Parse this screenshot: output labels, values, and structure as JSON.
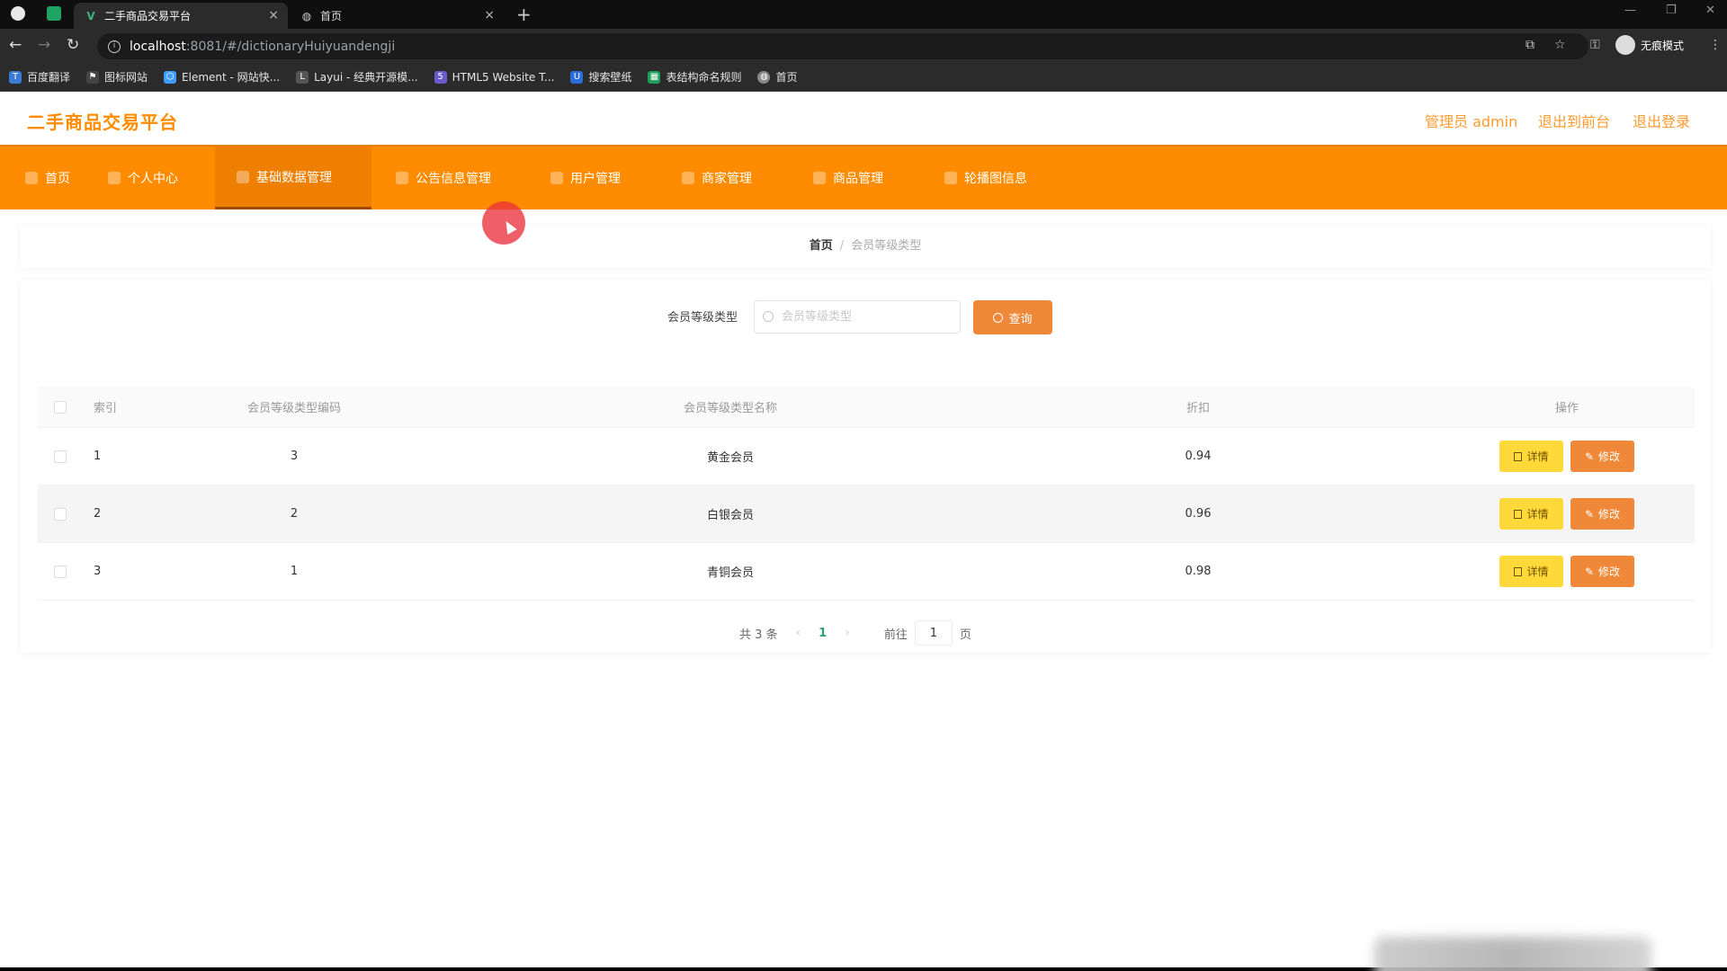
{
  "browser": {
    "tabs": [
      {
        "title": "二手商品交易平台",
        "active": true
      },
      {
        "title": "首页",
        "active": false
      }
    ],
    "address": {
      "host": "localhost",
      "path": ":8081/#/dictionaryHuiyuandengji"
    },
    "profile_label": "无痕模式",
    "bookmarks": [
      {
        "label": "百度翻译",
        "icon": "translate-icon",
        "color": "#3a7bd5"
      },
      {
        "label": "图标网站",
        "icon": "flag-icon",
        "color": "#444444"
      },
      {
        "label": "Element - 网站快...",
        "icon": "element-icon",
        "color": "#409eff"
      },
      {
        "label": "Layui - 经典开源模...",
        "icon": "layui-icon",
        "color": "#555555"
      },
      {
        "label": "HTML5 Website T...",
        "icon": "html5-icon",
        "color": "#6a5acd"
      },
      {
        "label": "搜索壁纸",
        "icon": "wallpaper-icon",
        "color": "#2b6cd9"
      },
      {
        "label": "表结构命名规则",
        "icon": "sheet-icon",
        "color": "#1e9e5a"
      },
      {
        "label": "首页",
        "icon": "globe-icon",
        "color": "#888888"
      }
    ]
  },
  "app": {
    "title": "二手商品交易平台",
    "header_links": {
      "admin": "管理员 admin",
      "front": "退出到前台",
      "logout": "退出登录"
    },
    "nav": [
      {
        "label": "首页",
        "active": false
      },
      {
        "label": "个人中心",
        "active": false
      },
      {
        "label": "基础数据管理",
        "active": true
      },
      {
        "label": "公告信息管理",
        "active": false
      },
      {
        "label": "用户管理",
        "active": false
      },
      {
        "label": "商家管理",
        "active": false
      },
      {
        "label": "商品管理",
        "active": false
      },
      {
        "label": "轮播图信息",
        "active": false
      }
    ],
    "breadcrumb": {
      "home": "首页",
      "separator": "/",
      "current": "会员等级类型"
    },
    "search": {
      "label": "会员等级类型",
      "placeholder": "会员等级类型",
      "button": "查询"
    },
    "table": {
      "headers": {
        "index": "索引",
        "code": "会员等级类型编码",
        "name": "会员等级类型名称",
        "discount": "折扣",
        "ops": "操作"
      },
      "rows": [
        {
          "index": "1",
          "code": "3",
          "name": "黄金会员",
          "discount": "0.94"
        },
        {
          "index": "2",
          "code": "2",
          "name": "白银会员",
          "discount": "0.96"
        },
        {
          "index": "3",
          "code": "1",
          "name": "青铜会员",
          "discount": "0.98"
        }
      ],
      "detail_label": "详情",
      "edit_label": "修改"
    },
    "pager": {
      "total": "共 3 条",
      "current": "1",
      "goto_prefix": "前往",
      "goto_value": "1",
      "goto_suffix": "页"
    }
  },
  "colors": {
    "accent": "#ff8c00",
    "edit_button": "#f0883a",
    "detail_button": "#ffd83a",
    "pager_active": "#2aa17a"
  }
}
